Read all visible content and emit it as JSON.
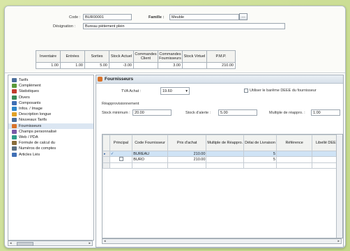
{
  "header": {
    "code_label": "Code :",
    "code_value": "BUR00001",
    "famille_label": "Famille :",
    "famille_value": "Meuble",
    "designation_label": "Désignation :",
    "designation_value": "Bureau piètement plein"
  },
  "stock": {
    "columns": [
      "Inventaire",
      "Entrées",
      "Sorties",
      "Stock Actuel",
      "Commandes Client",
      "Commandes Fournisseurs",
      "Stock Virtuel",
      "P.M.P."
    ],
    "values": [
      "1.00",
      "1.00",
      "5.00",
      "-3.00",
      "",
      "3.00",
      "",
      "210.00"
    ]
  },
  "sidebar": {
    "items": [
      {
        "label": "Tarifs",
        "icon": "price-list-icon",
        "color": "#4a6e9c"
      },
      {
        "label": "Complément",
        "icon": "complement-icon",
        "color": "#5b9a3a"
      },
      {
        "label": "Statistiques",
        "icon": "statistics-icon",
        "color": "#c23b2d"
      },
      {
        "label": "Divers",
        "icon": "misc-icon",
        "color": "#3a8a57"
      },
      {
        "label": "Composants",
        "icon": "components-icon",
        "color": "#3f6fb5"
      },
      {
        "label": "Infos. / Image",
        "icon": "image-icon",
        "color": "#2f86c9"
      },
      {
        "label": "Description longue",
        "icon": "description-icon",
        "color": "#e0a126"
      },
      {
        "label": "Nouveaux Tarifs",
        "icon": "new-price-icon",
        "color": "#4a6e9c"
      },
      {
        "label": "Fournisseurs",
        "icon": "supplier-icon",
        "color": "#d8732a"
      },
      {
        "label": "Champs personnalisé",
        "icon": "custom-fields-icon",
        "color": "#7a5aa8"
      },
      {
        "label": "Web / PDA",
        "icon": "web-icon",
        "color": "#2f9c8a"
      },
      {
        "label": "Formule de calcul du",
        "icon": "formula-icon",
        "color": "#8a6d3b"
      },
      {
        "label": "Numéros de comptes",
        "icon": "account-numbers-icon",
        "color": "#5b6f82"
      },
      {
        "label": "Articles Liés",
        "icon": "linked-items-icon",
        "color": "#3f6fb5"
      }
    ]
  },
  "panel": {
    "title": "Fournisseurs",
    "tva_label": "TVA Achat :",
    "tva_value": "19.60",
    "deee_label": "Utiliser le barême DEEE du fournisseur",
    "reappro_label": "Réapprovisionnement",
    "stock_min_label": "Stock minimum :",
    "stock_min_value": "20.00",
    "stock_alerte_label": "Stock d'alerte :",
    "stock_alerte_value": "5.00",
    "multiple_label": "Multiple de réappro. :",
    "multiple_value": "1.00"
  },
  "grid": {
    "columns": [
      "Principal",
      "Code Fournisseur",
      "Prix d'achat",
      "Multiple de Réappro.",
      "Délai de Livraison",
      "Référence",
      "Libellé DEEE"
    ],
    "rows": [
      {
        "principal": true,
        "code": "BUREAU",
        "prix": "210.00",
        "multiple": "",
        "delai": "5",
        "reference": "",
        "deee": ""
      },
      {
        "principal": false,
        "code": "BURO",
        "prix": "210.00",
        "multiple": "",
        "delai": "5",
        "reference": "",
        "deee": ""
      }
    ]
  }
}
